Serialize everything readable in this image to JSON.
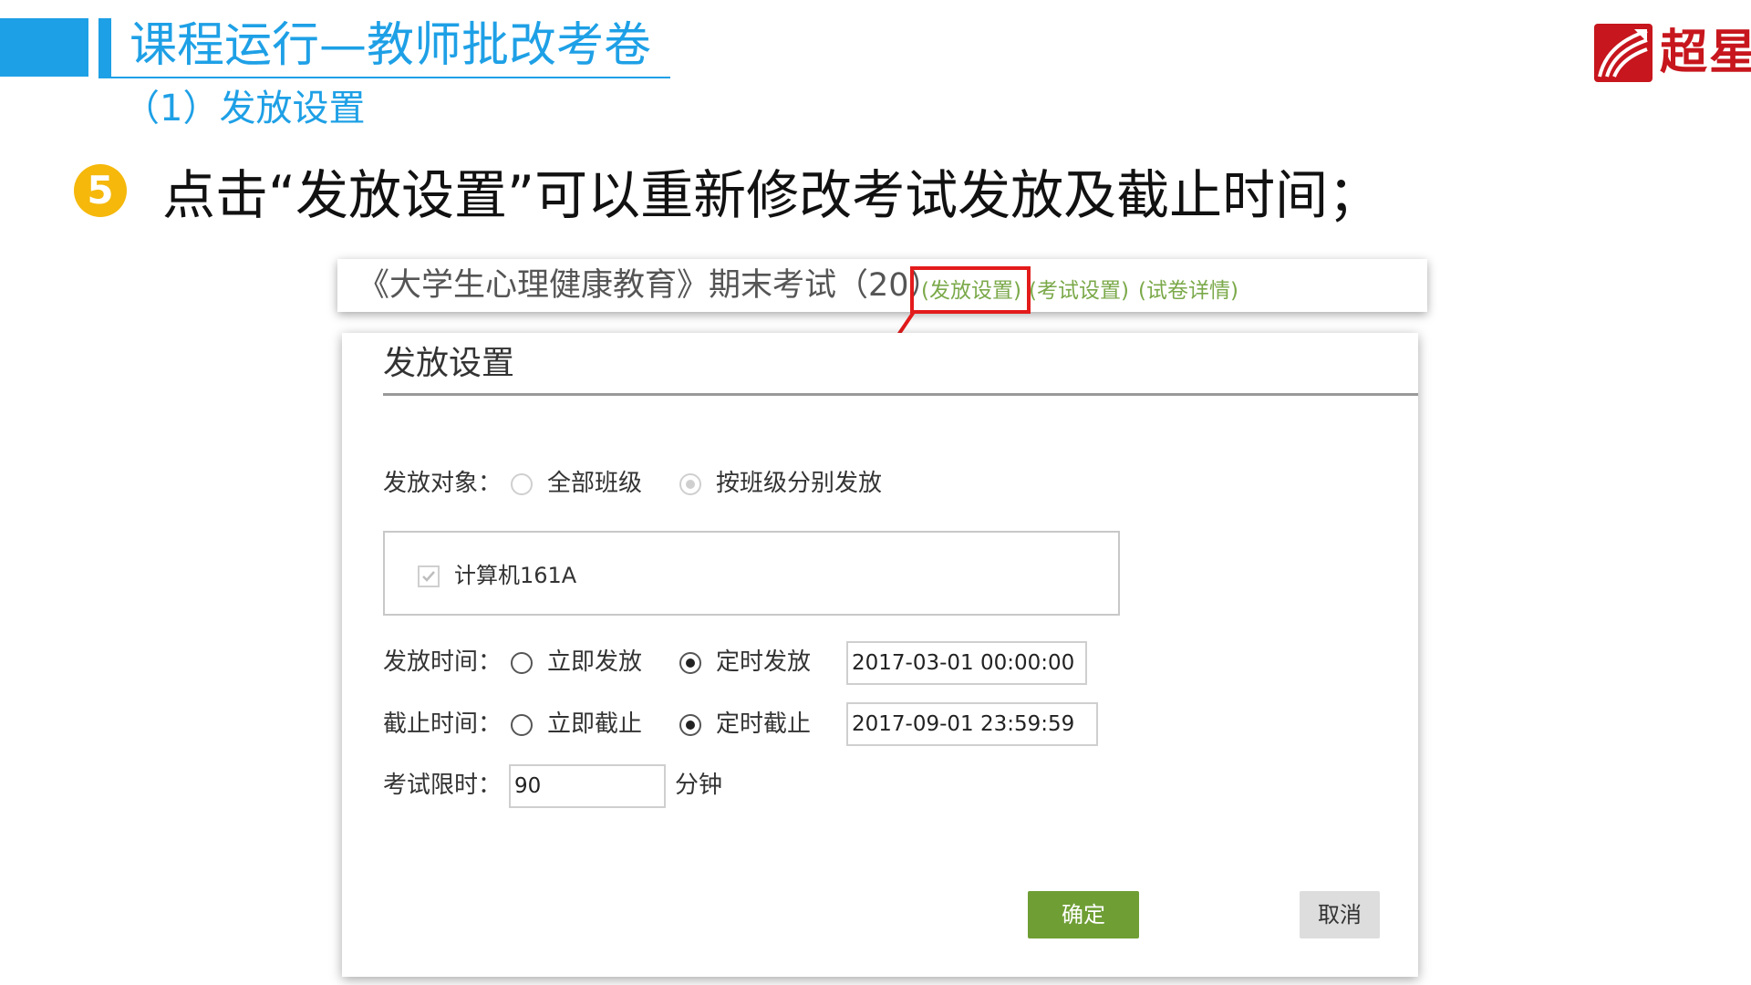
{
  "slide": {
    "title": "课程运行—教师批改考卷",
    "subtitle": "（1）发放设置",
    "logo_text": "超星"
  },
  "instruction": {
    "step_number": "5",
    "text": "点击“发放设置”可以重新修改考试发放及截止时间；"
  },
  "exam_header": {
    "title": "《大学生心理健康教育》期末考试（20）",
    "links": [
      "(发放设置)",
      "(考试设置)",
      "(试卷详情)"
    ]
  },
  "dialog": {
    "title": "发放设置",
    "target": {
      "label": "发放对象：",
      "options": [
        "全部班级",
        "按班级分别发放"
      ],
      "selected": 1
    },
    "classes": [
      {
        "name": "计算机161A",
        "checked": true
      }
    ],
    "release_time": {
      "label": "发放时间：",
      "options": [
        "立即发放",
        "定时发放"
      ],
      "selected": 1,
      "value": "2017-03-01 00:00:00"
    },
    "deadline": {
      "label": "截止时间：",
      "options": [
        "立即截止",
        "定时截止"
      ],
      "selected": 1,
      "value": "2017-09-01 23:59:59"
    },
    "time_limit": {
      "label": "考试限时：",
      "value": "90",
      "unit": "分钟"
    },
    "confirm_label": "确定",
    "cancel_label": "取消"
  },
  "colors": {
    "accent": "#1ea0e6",
    "link": "#7ba94a",
    "highlight": "#e31b1b",
    "confirm": "#6f9e35",
    "logo": "#c7161d",
    "badge": "#f5b80b"
  }
}
